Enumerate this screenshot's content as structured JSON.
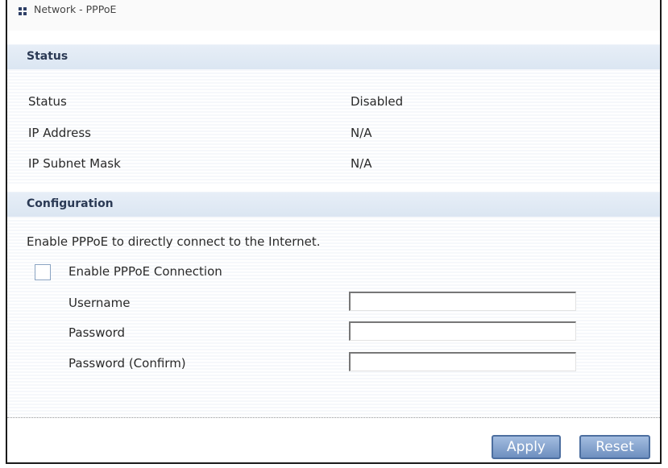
{
  "window": {
    "title": "Network - PPPoE"
  },
  "status_section": {
    "heading": "Status",
    "rows": [
      {
        "label": "Status",
        "value": "Disabled"
      },
      {
        "label": "IP Address",
        "value": "N/A"
      },
      {
        "label": "IP Subnet Mask",
        "value": "N/A"
      }
    ]
  },
  "config_section": {
    "heading": "Configuration",
    "description": "Enable PPPoE to directly connect to the Internet.",
    "enable_checkbox": {
      "label": "Enable PPPoE Connection",
      "checked": false
    },
    "fields": [
      {
        "label": "Username",
        "value": ""
      },
      {
        "label": "Password",
        "value": ""
      },
      {
        "label": "Password (Confirm)",
        "value": ""
      }
    ]
  },
  "buttons": {
    "apply": "Apply",
    "reset": "Reset"
  },
  "icons": {
    "title_icon": "grid-icon"
  },
  "colors": {
    "section_bar": "#dfe8f3",
    "button": "#7f9fcf",
    "section_heading": "#2b3a55"
  }
}
